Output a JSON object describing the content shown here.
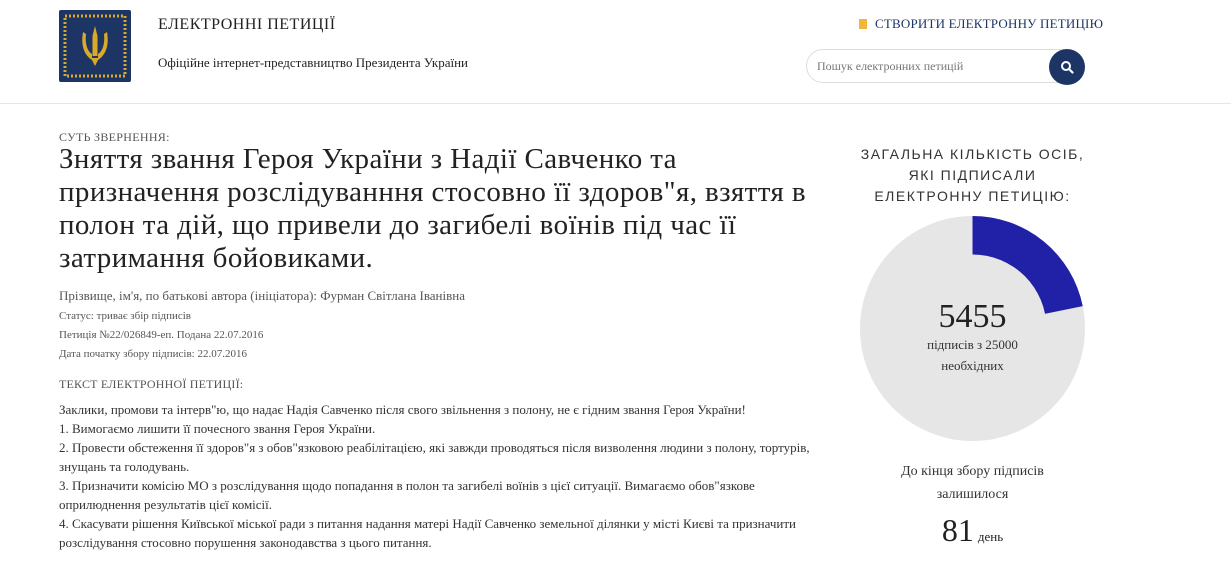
{
  "header": {
    "site_title": "ЕЛЕКТРОННІ ПЕТИЦІЇ",
    "site_subtitle": "Офіційне інтернет-представництво Президента України",
    "create_link": "СТВОРИТИ ЕЛЕКТРОННУ ПЕТИЦІЮ",
    "search_placeholder": "Пошук електронних петицій",
    "icons": {
      "logo": "trident-emblem",
      "create": "pencil-icon",
      "search": "search-icon"
    },
    "colors": {
      "brand": "#1c3564",
      "accent": "#f3b63a"
    }
  },
  "petition": {
    "kicker": "СУТЬ ЗВЕРНЕННЯ:",
    "title": "Зняття звання Героя України з Надії Савченко та призначення розслідуванння стосовно її здоров\"я, взяття в полон та дій, що привели до загибелі воїнів під час її затримання бойовиками.",
    "author": "Прізвище, ім'я, по батькові автора (ініціатора): Фурман Світлана Іванівна",
    "status": "Статус: триває збір підписів",
    "number": "Петиція №22/026849-еп. Подана 22.07.2016",
    "start_date": "Дата початку збору підписів: 22.07.2016",
    "text_heading": "ТЕКСТ ЕЛЕКТРОННОЇ ПЕТИЦІЇ:",
    "text_lines": [
      "Заклики, промови та інтерв\"ю, що надає Надія Савченко після свого звільнення з полону, не є гідним звання Героя України!",
      "1. Вимогаємо лишити її почесного звання Героя України.",
      "2. Провести обстеження її здоров\"я з обов\"язковою реабілітацією, які завжди проводяться після визволення людини з полону, тортурів, знущань та голодувань.",
      "3. Призначити комісію МО з розслідування щодо попадання в полон та загибелі воїнів з цієї ситуації. Вимагаємо обов\"язкове оприлюднення результатів цієї комісії.",
      "4. Скасувати рішення Київської міської ради з питання надання матері Надії Савченко земельної ділянки у місті Києві та призначити розслідування стосовно порушення законодавства з цього питання."
    ]
  },
  "sidebar": {
    "heading_lines": [
      "ЗАГАЛЬНА КІЛЬКІСТЬ ОСІБ,",
      "ЯКІ ПІДПИСАЛИ",
      "ЕЛЕКТРОННУ ПЕТИЦІЮ:"
    ],
    "signatures": 5455,
    "signatures_text": "5455",
    "goal_line1": "підписів з 25000",
    "goal_line2": "необхідних",
    "goal": 25000,
    "progress_fraction": 0.2182,
    "progress_color": "#2121a8",
    "track_color": "#e6e6e6",
    "remain_line1": "До кінця збору підписів",
    "remain_line2": "залишилося",
    "days_left": "81",
    "days_unit": "день"
  }
}
